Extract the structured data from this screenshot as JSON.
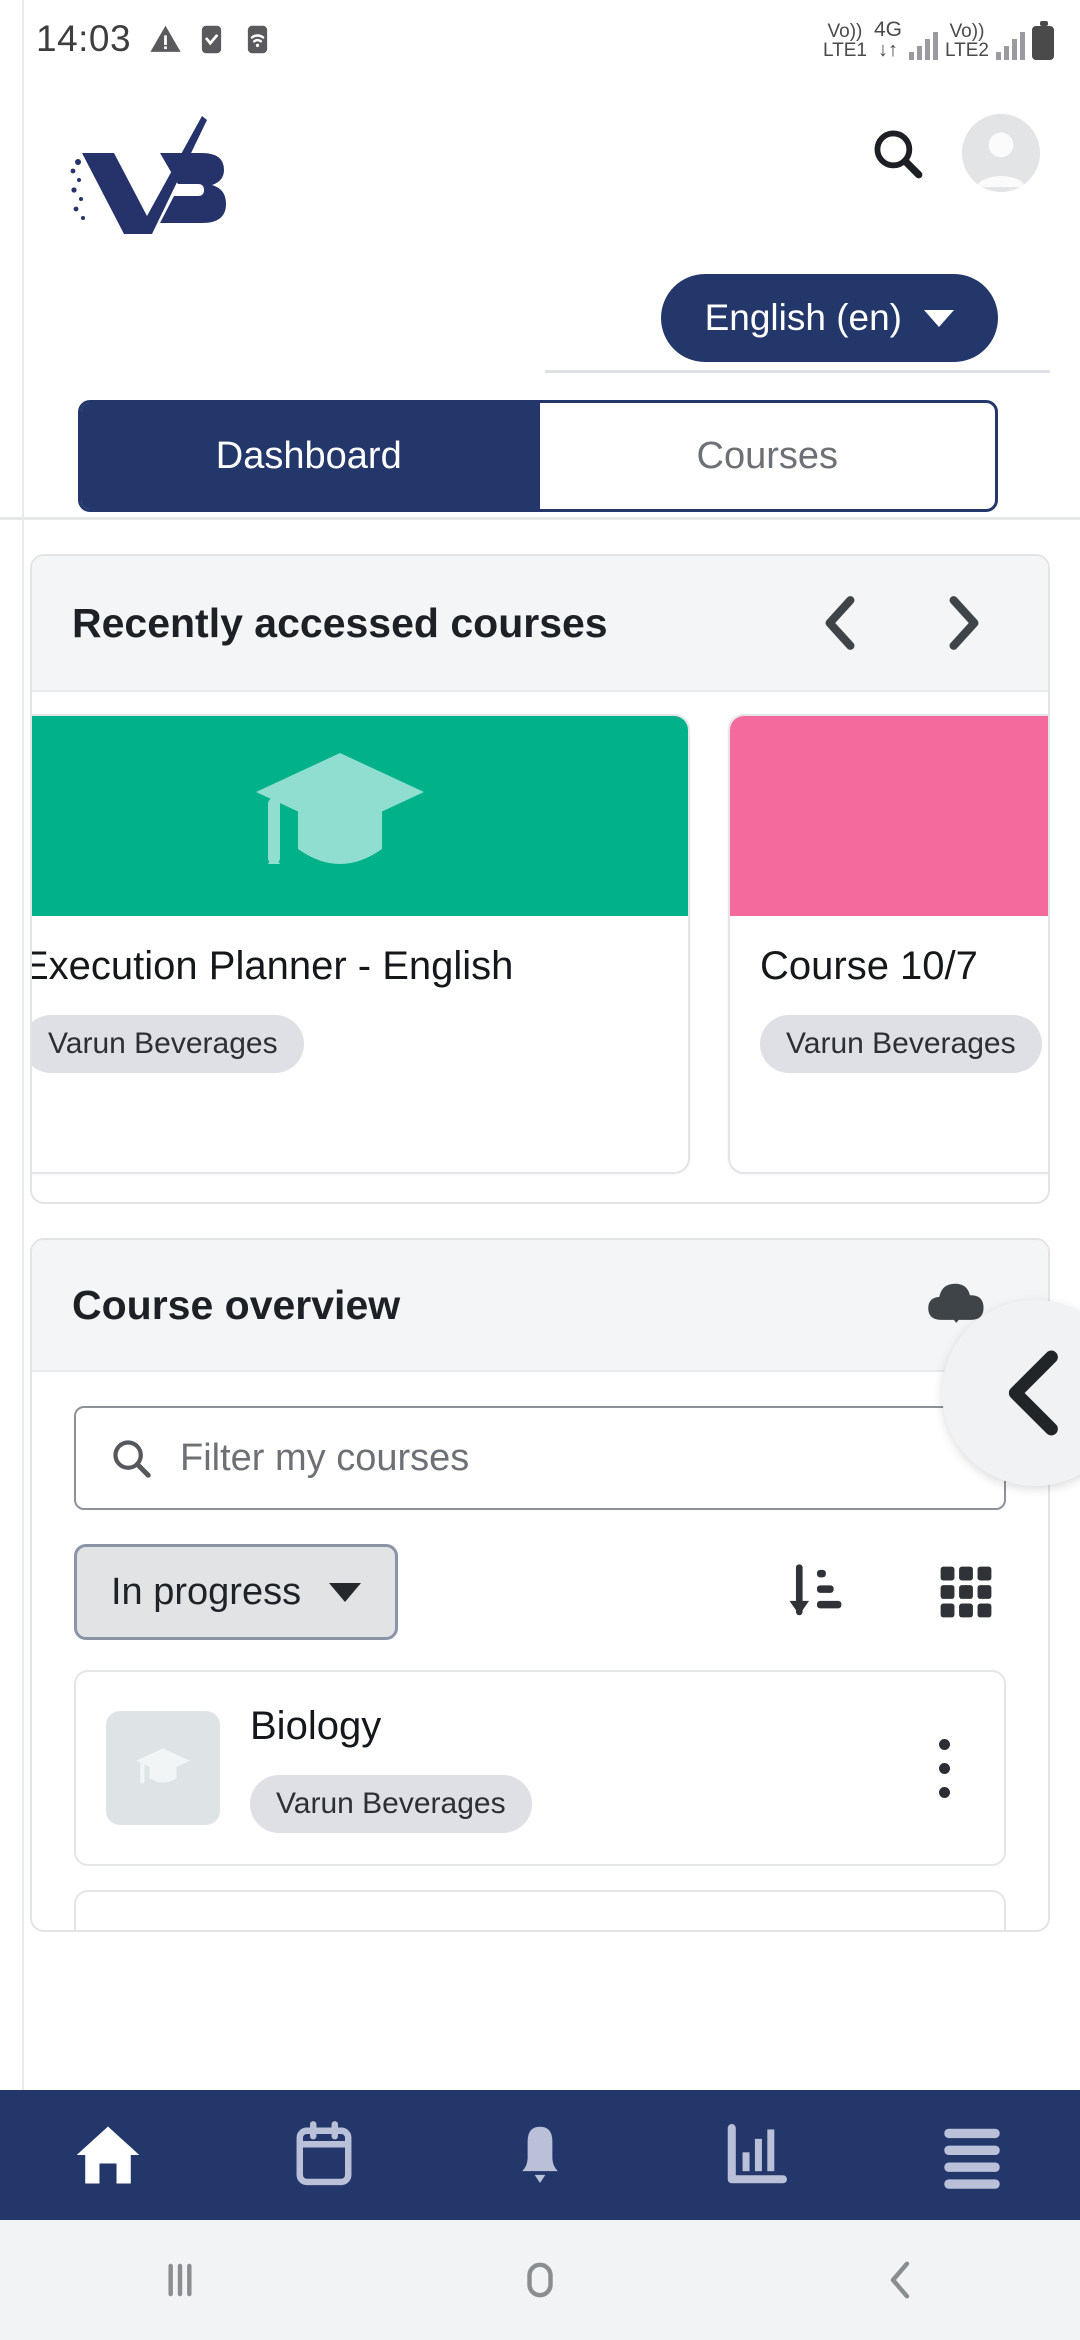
{
  "status_bar": {
    "time": "14:03",
    "left_icons": [
      "warning-triangle-icon",
      "checkbox-checked-icon",
      "wifi-icon"
    ],
    "sim1_label_top": "Vo))",
    "sim1_label_bottom": "LTE1",
    "network_top": "4G",
    "network_bottom": "↓↑",
    "sim2_label_top": "Vo))",
    "sim2_label_bottom": "LTE2"
  },
  "header": {
    "logo_text": "VB",
    "search_icon": "search-icon",
    "avatar_icon": "user-avatar-icon"
  },
  "language": {
    "label": "English (en)",
    "caret": "chevron-down-icon"
  },
  "tabs": [
    {
      "label": "Dashboard",
      "active": true
    },
    {
      "label": "Courses",
      "active": false
    }
  ],
  "recently_accessed": {
    "title": "Recently accessed courses",
    "prev_icon": "chevron-left-icon",
    "next_icon": "chevron-right-icon",
    "cards": [
      {
        "title": "Execution Planner - English",
        "chip": "Varun Beverages",
        "color": "#00b189",
        "image_icon": "graduation-cap-icon"
      },
      {
        "title": "Course 10/7",
        "chip": "Varun Beverages",
        "color": "#f56a9c",
        "image_icon": ""
      }
    ]
  },
  "course_overview": {
    "title": "Course overview",
    "download_icon": "cloud-download-icon",
    "search_placeholder": "Filter my courses",
    "search_icon": "search-icon",
    "filter_value": "In progress",
    "filter_caret": "chevron-down-icon",
    "sort_icon": "sort-descending-icon",
    "view_icon": "grid-view-icon",
    "courses": [
      {
        "title": "Biology",
        "chip": "Varun Beverages",
        "menu_icon": "three-dot-menu-icon",
        "thumb_icon": "graduation-cap-icon"
      }
    ]
  },
  "floating_action": {
    "icon": "chevron-left-icon"
  },
  "bottom_nav": [
    {
      "name": "home",
      "icon": "home-icon",
      "active": true
    },
    {
      "name": "calendar",
      "icon": "calendar-icon",
      "active": false
    },
    {
      "name": "notifications",
      "icon": "bell-icon",
      "active": false
    },
    {
      "name": "grades",
      "icon": "bar-chart-icon",
      "active": false
    },
    {
      "name": "menu",
      "icon": "hamburger-menu-icon",
      "active": false
    }
  ],
  "android_nav": [
    {
      "name": "recents",
      "icon": "recents-icon"
    },
    {
      "name": "home",
      "icon": "home-circle-icon"
    },
    {
      "name": "back",
      "icon": "back-chevron-icon"
    }
  ],
  "colors": {
    "brand_navy": "#23376b",
    "card_teal": "#00b189",
    "card_pink": "#f56a9c",
    "panel_grey": "#f4f5f6"
  }
}
